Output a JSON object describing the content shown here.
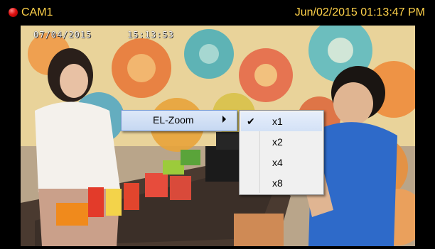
{
  "titlebar": {
    "camera_name": "CAM1",
    "timestamp": "Jun/02/2015 01:13:47 PM",
    "record_indicator_color": "#e01010",
    "text_color": "#ffd24a"
  },
  "video": {
    "osd_date": "07/04/2015",
    "osd_time": "15:13:53"
  },
  "context_menu": {
    "item_label": "EL-Zoom",
    "submenu_arrow_icon": "chevron-right-icon"
  },
  "zoom_submenu": {
    "options": [
      {
        "label": "x1",
        "checked": true
      },
      {
        "label": "x2",
        "checked": false
      },
      {
        "label": "x4",
        "checked": false
      },
      {
        "label": "x8",
        "checked": false
      }
    ],
    "check_glyph": "✔"
  }
}
